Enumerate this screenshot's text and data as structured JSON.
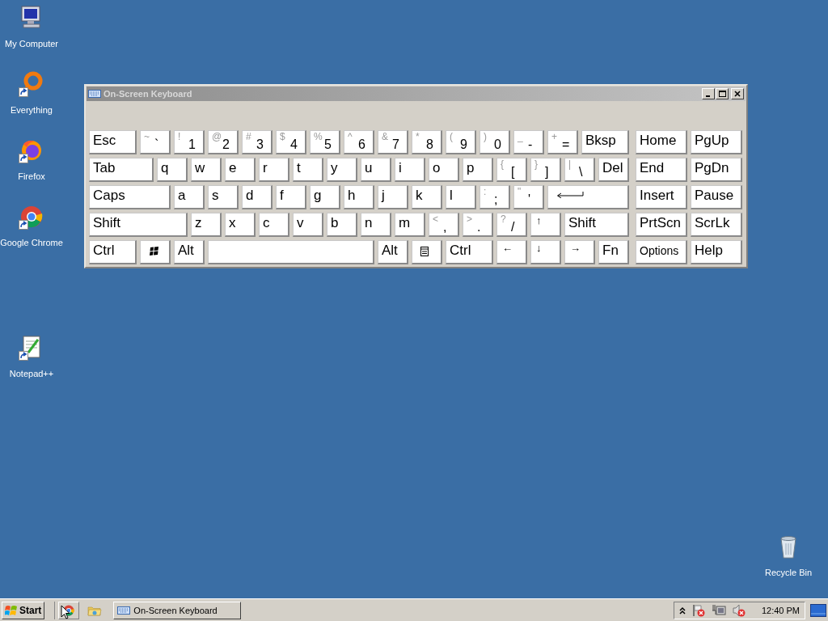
{
  "desktop_icons": [
    {
      "label": "My Computer",
      "kind": "computer",
      "shortcut": false
    },
    {
      "label": "Everything",
      "kind": "everything",
      "shortcut": true
    },
    {
      "label": "Firefox",
      "kind": "firefox",
      "shortcut": true
    },
    {
      "label": "Google Chrome",
      "kind": "chrome",
      "shortcut": true
    },
    {
      "label": "Notepad++",
      "kind": "notepad",
      "shortcut": true
    },
    {
      "label": "Recycle Bin",
      "kind": "recycle",
      "shortcut": false
    }
  ],
  "window": {
    "title": "On-Screen Keyboard",
    "main_rows": [
      [
        {
          "label": "Esc"
        },
        {
          "shift": "~",
          "label": "`"
        },
        {
          "shift": "!",
          "label": "1"
        },
        {
          "shift": "@",
          "label": "2"
        },
        {
          "shift": "#",
          "label": "3"
        },
        {
          "shift": "$",
          "label": "4"
        },
        {
          "shift": "%",
          "label": "5"
        },
        {
          "shift": "^",
          "label": "6"
        },
        {
          "shift": "&",
          "label": "7"
        },
        {
          "shift": "*",
          "label": "8"
        },
        {
          "shift": "(",
          "label": "9"
        },
        {
          "shift": ")",
          "label": "0"
        },
        {
          "shift": "_",
          "label": "-"
        },
        {
          "shift": "+",
          "label": "="
        },
        {
          "label": "Bksp"
        }
      ],
      [
        {
          "label": "Tab"
        },
        {
          "label": "q"
        },
        {
          "label": "w"
        },
        {
          "label": "e"
        },
        {
          "label": "r"
        },
        {
          "label": "t"
        },
        {
          "label": "y"
        },
        {
          "label": "u"
        },
        {
          "label": "i"
        },
        {
          "label": "o"
        },
        {
          "label": "p"
        },
        {
          "shift": "{",
          "label": "["
        },
        {
          "shift": "}",
          "label": "]"
        },
        {
          "shift": "|",
          "label": "\\"
        },
        {
          "label": "Del"
        }
      ],
      [
        {
          "label": "Caps"
        },
        {
          "label": "a"
        },
        {
          "label": "s"
        },
        {
          "label": "d"
        },
        {
          "label": "f"
        },
        {
          "label": "g"
        },
        {
          "label": "h"
        },
        {
          "label": "j"
        },
        {
          "label": "k"
        },
        {
          "label": "l"
        },
        {
          "shift": ":",
          "label": ";"
        },
        {
          "shift": "\"",
          "label": "'"
        },
        {
          "kind": "enter"
        }
      ],
      [
        {
          "label": "Shift"
        },
        {
          "label": "z"
        },
        {
          "label": "x"
        },
        {
          "label": "c"
        },
        {
          "label": "v"
        },
        {
          "label": "b"
        },
        {
          "label": "n"
        },
        {
          "label": "m"
        },
        {
          "shift": "<",
          "label": ","
        },
        {
          "shift": ">",
          "label": "."
        },
        {
          "shift": "?",
          "label": "/"
        },
        {
          "label": "↑",
          "kind": "arrow"
        },
        {
          "label": "Shift"
        }
      ],
      [
        {
          "label": "Ctrl"
        },
        {
          "kind": "windows"
        },
        {
          "label": "Alt"
        },
        {
          "kind": "space"
        },
        {
          "label": "Alt"
        },
        {
          "kind": "menu"
        },
        {
          "label": "Ctrl"
        },
        {
          "label": "←",
          "kind": "arrow"
        },
        {
          "label": "↓",
          "kind": "arrow"
        },
        {
          "label": "→",
          "kind": "arrow"
        },
        {
          "label": "Fn"
        }
      ]
    ],
    "side_rows": [
      [
        {
          "label": "Home"
        },
        {
          "label": "PgUp"
        }
      ],
      [
        {
          "label": "End"
        },
        {
          "label": "PgDn"
        }
      ],
      [
        {
          "label": "Insert"
        },
        {
          "label": "Pause"
        }
      ],
      [
        {
          "label": "PrtScn"
        },
        {
          "label": "ScrLk"
        }
      ],
      [
        {
          "label": "Options",
          "kind": "small"
        },
        {
          "label": "Help"
        }
      ]
    ]
  },
  "taskbar": {
    "start": "Start",
    "quick_launch": [
      {
        "kind": "chrome"
      },
      {
        "kind": "folder"
      }
    ],
    "tasks": [
      {
        "label": "On-Screen Keyboard"
      }
    ],
    "tray_icons": [
      {
        "kind": "chevron"
      },
      {
        "kind": "flag"
      },
      {
        "kind": "network"
      },
      {
        "kind": "speaker"
      }
    ],
    "clock": "12:40 PM"
  }
}
